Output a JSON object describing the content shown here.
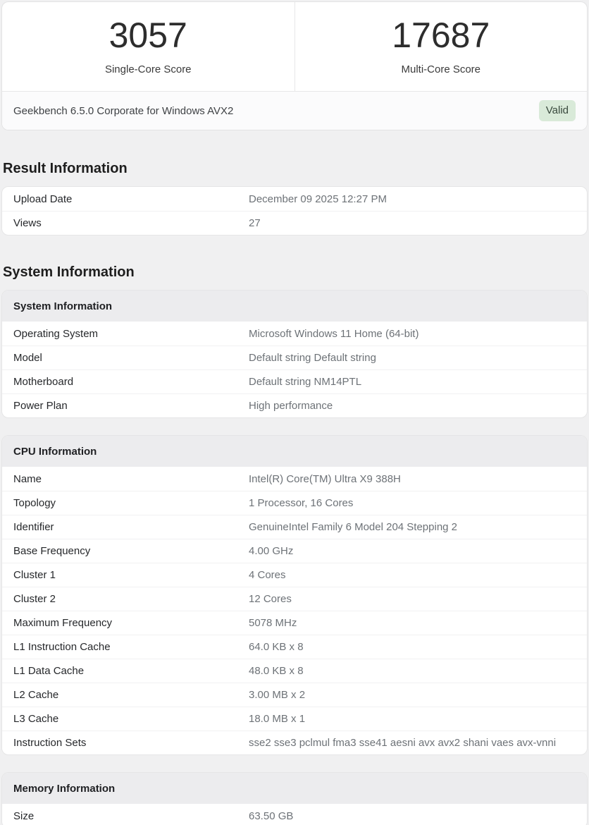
{
  "scores": {
    "single_core": {
      "value": "3057",
      "label": "Single-Core Score"
    },
    "multi_core": {
      "value": "17687",
      "label": "Multi-Core Score"
    }
  },
  "version_bar": {
    "version": "Geekbench 6.5.0 Corporate for Windows AVX2",
    "badge": "Valid"
  },
  "result_information": {
    "title": "Result Information",
    "rows": [
      {
        "label": "Upload Date",
        "value": "December 09 2025 12:27 PM"
      },
      {
        "label": "Views",
        "value": "27"
      }
    ]
  },
  "system_information": {
    "title": "System Information",
    "cards": [
      {
        "header": "System Information",
        "rows": [
          {
            "label": "Operating System",
            "value": "Microsoft Windows 11 Home (64-bit)"
          },
          {
            "label": "Model",
            "value": "Default string Default string"
          },
          {
            "label": "Motherboard",
            "value": "Default string NM14PTL"
          },
          {
            "label": "Power Plan",
            "value": "High performance"
          }
        ]
      },
      {
        "header": "CPU Information",
        "rows": [
          {
            "label": "Name",
            "value": "Intel(R) Core(TM) Ultra X9 388H"
          },
          {
            "label": "Topology",
            "value": "1 Processor, 16 Cores"
          },
          {
            "label": "Identifier",
            "value": "GenuineIntel Family 6 Model 204 Stepping 2"
          },
          {
            "label": "Base Frequency",
            "value": "4.00 GHz"
          },
          {
            "label": "Cluster 1",
            "value": "4 Cores"
          },
          {
            "label": "Cluster 2",
            "value": "12 Cores"
          },
          {
            "label": "Maximum Frequency",
            "value": "5078 MHz"
          },
          {
            "label": "L1 Instruction Cache",
            "value": "64.0 KB x 8"
          },
          {
            "label": "L1 Data Cache",
            "value": "48.0 KB x 8"
          },
          {
            "label": "L2 Cache",
            "value": "3.00 MB x 2"
          },
          {
            "label": "L3 Cache",
            "value": "18.0 MB x 1"
          },
          {
            "label": "Instruction Sets",
            "value": "sse2 sse3 pclmul fma3 sse41 aesni avx avx2 shani vaes avx-vnni"
          }
        ]
      },
      {
        "header": "Memory Information",
        "rows": [
          {
            "label": "Size",
            "value": "63.50 GB"
          }
        ]
      }
    ]
  },
  "colors": {
    "badge_bg": "#d9ead9",
    "badge_text": "#39493d",
    "page_bg": "#f0f0f1",
    "card_header_bg": "#ececee"
  }
}
